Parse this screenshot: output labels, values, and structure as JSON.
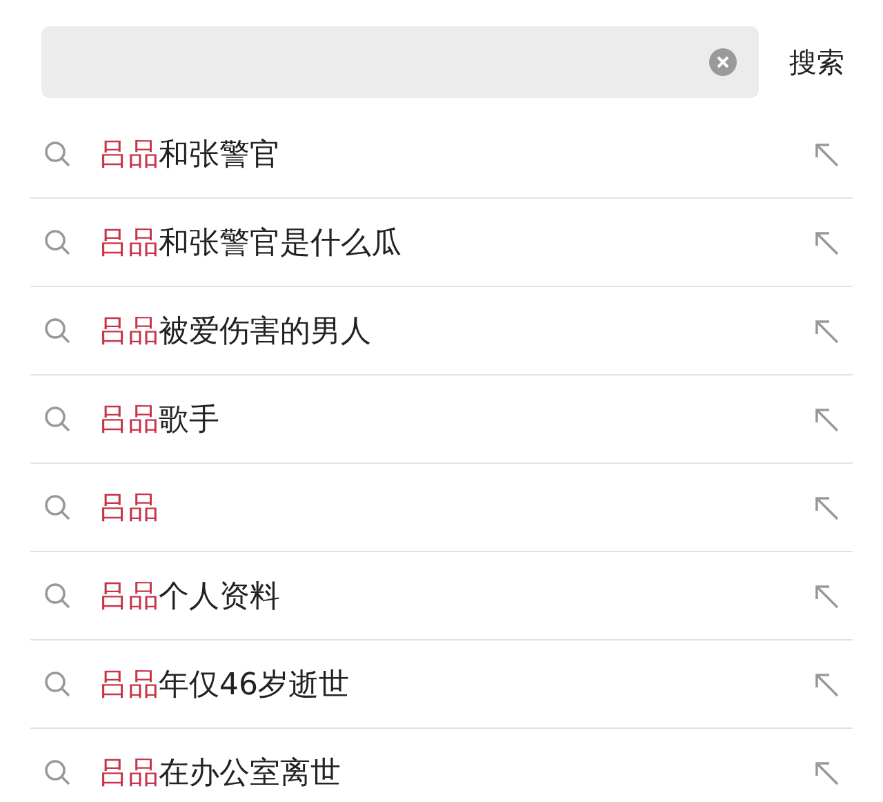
{
  "search": {
    "button": "搜索"
  },
  "suggestions": [
    {
      "highlight": "吕品",
      "rest": "和张警官"
    },
    {
      "highlight": "吕品",
      "rest": "和张警官是什么瓜"
    },
    {
      "highlight": "吕品",
      "rest": "被爱伤害的男人"
    },
    {
      "highlight": "吕品",
      "rest": "歌手"
    },
    {
      "highlight": "吕品"
    },
    {
      "highlight": "吕品",
      "rest": "个人资料"
    },
    {
      "highlight": "吕品",
      "rest": "年仅46岁逝世"
    },
    {
      "highlight": "吕品",
      "rest": "在办公室离世"
    }
  ]
}
